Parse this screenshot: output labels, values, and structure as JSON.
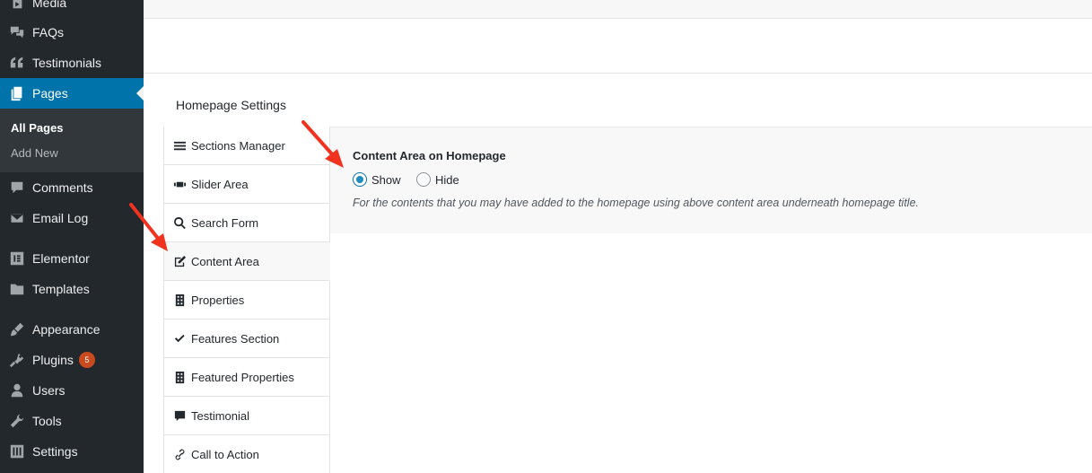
{
  "sidebar": {
    "items": [
      {
        "label": "Media",
        "icon": "media-icon"
      },
      {
        "label": "FAQs",
        "icon": "chat-bubbles-icon"
      },
      {
        "label": "Testimonials",
        "icon": "quote-icon"
      },
      {
        "label": "Pages",
        "icon": "pages-icon"
      },
      {
        "label": "Comments",
        "icon": "comment-icon"
      },
      {
        "label": "Email Log",
        "icon": "email-icon"
      },
      {
        "label": "Elementor",
        "icon": "elementor-icon"
      },
      {
        "label": "Templates",
        "icon": "folder-icon"
      },
      {
        "label": "Appearance",
        "icon": "brush-icon"
      },
      {
        "label": "Plugins",
        "icon": "plug-icon"
      },
      {
        "label": "Users",
        "icon": "user-icon"
      },
      {
        "label": "Tools",
        "icon": "wrench-icon"
      },
      {
        "label": "Settings",
        "icon": "settings-sliders-icon"
      }
    ],
    "plugins_badge": "5",
    "submenu": {
      "all_pages": "All Pages",
      "add_new": "Add New"
    }
  },
  "panel": {
    "title": "Homepage Settings",
    "tabs": [
      {
        "label": "Sections Manager",
        "icon": "menu-lines-icon"
      },
      {
        "label": "Slider Area",
        "icon": "slider-icon"
      },
      {
        "label": "Search Form",
        "icon": "search-icon"
      },
      {
        "label": "Content Area",
        "icon": "edit-icon"
      },
      {
        "label": "Properties",
        "icon": "building-icon"
      },
      {
        "label": "Features Section",
        "icon": "checkmark-icon"
      },
      {
        "label": "Featured Properties",
        "icon": "building-icon"
      },
      {
        "label": "Testimonial",
        "icon": "comment-icon"
      },
      {
        "label": "Call to Action",
        "icon": "link-icon"
      }
    ],
    "active_tab": "Content Area"
  },
  "content": {
    "heading": "Content Area on Homepage",
    "options": [
      {
        "label": "Show",
        "checked": true
      },
      {
        "label": "Hide",
        "checked": false
      }
    ],
    "help": "For the contents that you may have added to the homepage using above content area underneath homepage title."
  },
  "colors": {
    "sidebar_bg": "#23282d",
    "active_menu": "#0073aa",
    "badge": "#ca4a1f",
    "annotation_arrow": "#f0321e"
  }
}
